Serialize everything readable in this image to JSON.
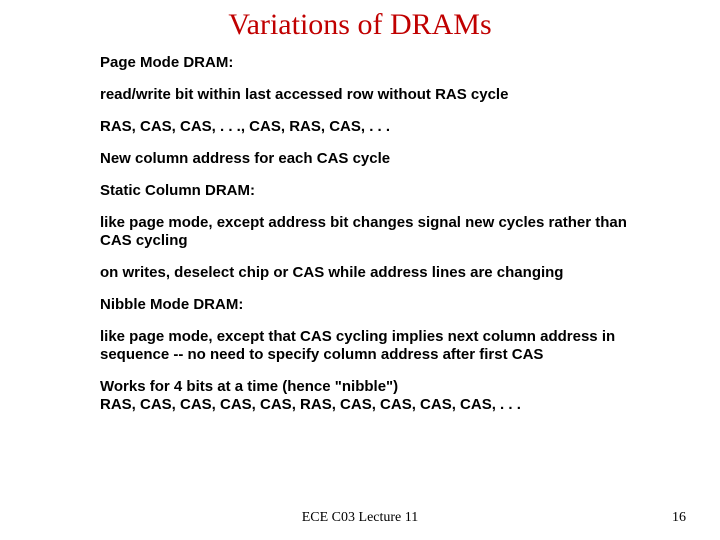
{
  "title": "Variations of DRAMs",
  "sections": {
    "pageMode": {
      "heading": "Page Mode DRAM:",
      "line1": "read/write bit within last accessed row without RAS cycle",
      "line2": "RAS, CAS, CAS, . . ., CAS, RAS, CAS, . . .",
      "line3": "New column address for each CAS cycle"
    },
    "staticCol": {
      "heading": "Static Column DRAM:",
      "line1": "like page mode, except address bit changes signal new cycles rather than CAS cycling",
      "line2": "on writes, deselect chip or CAS while address lines are changing"
    },
    "nibble": {
      "heading": "Nibble Mode DRAM:",
      "line1": "like page mode, except that CAS cycling implies next column address in sequence -- no need to specify column address after first CAS",
      "line2": "Works for 4 bits at a time (hence \"nibble\")",
      "line3": "RAS, CAS, CAS, CAS, CAS, RAS, CAS, CAS, CAS, CAS, . . ."
    }
  },
  "footer": {
    "center": "ECE C03 Lecture 11",
    "page": "16"
  }
}
